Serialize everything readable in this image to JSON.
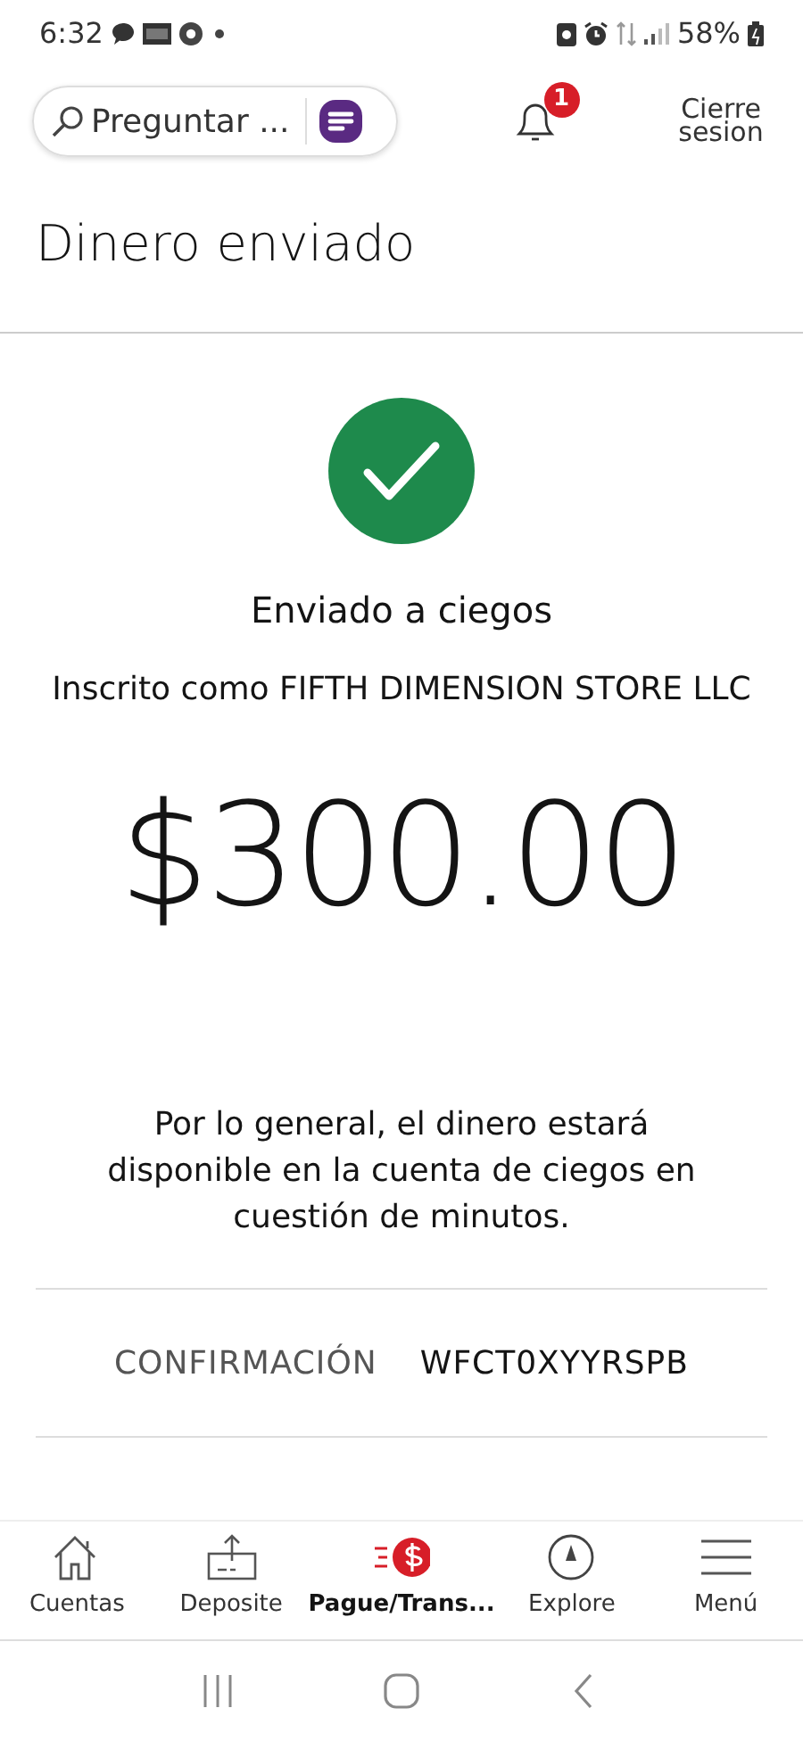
{
  "status_bar": {
    "time": "6:32",
    "battery": "58%"
  },
  "header": {
    "search": {
      "placeholder": "Preguntar ..."
    },
    "notifications": {
      "count": "1"
    },
    "logout": "Cierre sesion"
  },
  "title": "Dinero enviado",
  "result": {
    "heading": "Enviado a ciegos",
    "subheading": "Inscrito como FIFTH DIMENSION STORE LLC",
    "amount": "$300.00",
    "note": "Por lo general, el dinero estará disponible en la cuenta de ciegos en cuestión de minutos.",
    "confirmation": {
      "label": "CONFIRMACIÓN",
      "value": "WFCT0XYYRSPB"
    }
  },
  "bottom_nav": [
    {
      "kind": "house",
      "label": "Cuentas",
      "selected": false
    },
    {
      "kind": "deposit",
      "label": "Deposite",
      "selected": false
    },
    {
      "kind": "pay",
      "label": "Pague/Trans...",
      "selected": true
    },
    {
      "kind": "compass",
      "label": "Explore",
      "selected": false
    },
    {
      "kind": "menu",
      "label": "Menú",
      "selected": false
    }
  ]
}
